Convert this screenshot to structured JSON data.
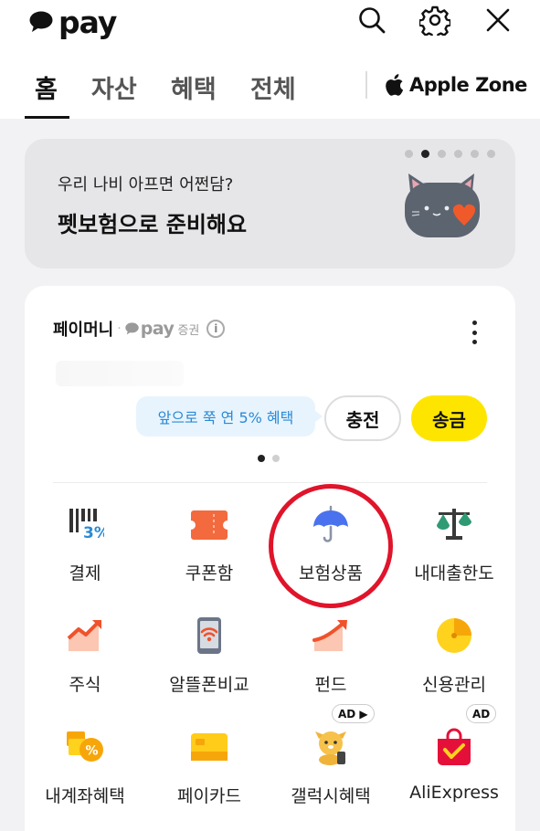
{
  "header": {
    "logo_text": "pay",
    "icons": [
      "search-icon",
      "gear-icon",
      "close-icon"
    ]
  },
  "tabs": [
    {
      "label": "홈",
      "active": true
    },
    {
      "label": "자산",
      "active": false
    },
    {
      "label": "혜택",
      "active": false
    },
    {
      "label": "전체",
      "active": false
    }
  ],
  "apple_zone": {
    "label": "Apple Zone"
  },
  "banner": {
    "subtitle": "우리 나비 아프면 어쩐담?",
    "title": "펫보험으로 준비해요",
    "pages": 6,
    "current_page": 2
  },
  "pay_money": {
    "label": "페이머니",
    "sep": "·",
    "brand": "pay",
    "securities": "증권",
    "info": "i",
    "tooltip": "앞으로 쭉 연 5% 혜택",
    "charge_label": "충전",
    "send_label": "송금",
    "pages": 2,
    "current_page": 1
  },
  "menu": [
    {
      "label": "결제",
      "icon": "payment-barcode-icon"
    },
    {
      "label": "쿠폰함",
      "icon": "coupon-icon"
    },
    {
      "label": "보험상품",
      "icon": "umbrella-icon"
    },
    {
      "label": "내대출한도",
      "icon": "scale-icon"
    },
    {
      "label": "주식",
      "icon": "stock-chart-icon"
    },
    {
      "label": "알뜰폰비교",
      "icon": "phone-compare-icon"
    },
    {
      "label": "펀드",
      "icon": "fund-chart-icon"
    },
    {
      "label": "신용관리",
      "icon": "credit-gauge-icon"
    },
    {
      "label": "내계좌혜택",
      "icon": "account-benefit-icon"
    },
    {
      "label": "페이카드",
      "icon": "pay-card-icon"
    },
    {
      "label": "갤럭시혜택",
      "icon": "galaxy-benefit-icon",
      "badge": "AD ▶"
    },
    {
      "label": "AliExpress",
      "icon": "aliexpress-bag-icon",
      "badge": "AD"
    }
  ],
  "colors": {
    "brand_yellow": "#fee500",
    "annotation_red": "#e0142a",
    "tooltip_blue": "#2a8ad6"
  }
}
